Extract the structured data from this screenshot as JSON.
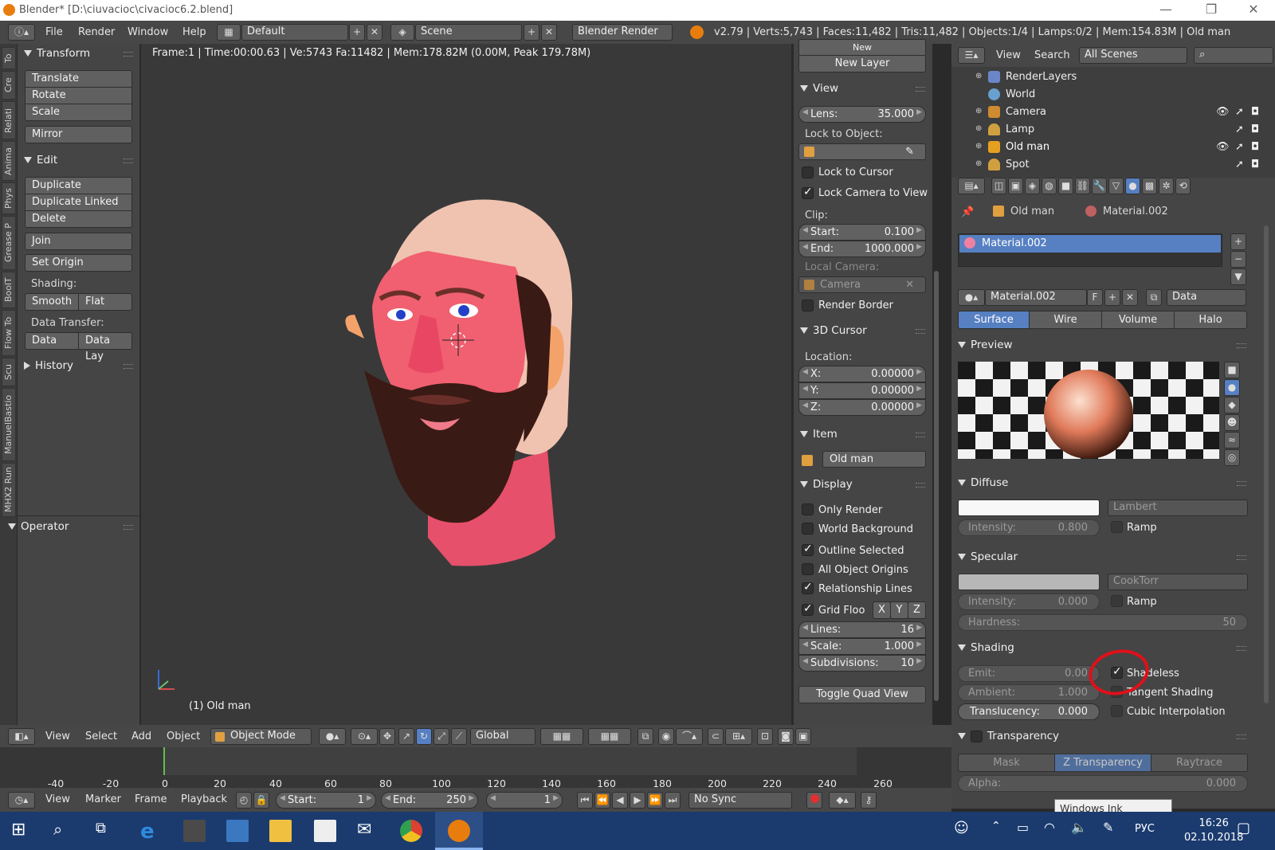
{
  "window": {
    "title": "Blender* [D:\\ciuvacioc\\civacioc6.2.blend]",
    "minimize": "—",
    "maximize": "❐",
    "close": "✕"
  },
  "infobar": {
    "menus": [
      "File",
      "Render",
      "Window",
      "Help"
    ],
    "layout": "Default",
    "scene": "Scene",
    "engine": "Blender Render",
    "stats": "v2.79 | Verts:5,743 | Faces:11,482 | Tris:11,482 | Objects:1/4 | Lamps:0/2 | Mem:154.83M | Old man"
  },
  "tooltabs": [
    "To",
    "Cre",
    "Relati",
    "Anima",
    "Phys",
    "Grease P",
    "BoolT",
    "Flow To",
    "Scu",
    "ManuelBastio",
    "MHX2 Run"
  ],
  "toolshelf": {
    "transform": {
      "title": "Transform",
      "buttons": [
        "Translate",
        "Rotate",
        "Scale",
        "Mirror"
      ]
    },
    "edit": {
      "title": "Edit",
      "buttons": [
        "Duplicate",
        "Duplicate Linked",
        "Delete",
        "Join"
      ],
      "set_origin": "Set Origin"
    },
    "shading_label": "Shading:",
    "shading": [
      "Smooth",
      "Flat"
    ],
    "data_transfer_label": "Data Transfer:",
    "data_transfer": [
      "Data",
      "Data Lay"
    ],
    "history": "History",
    "operator": "Operator"
  },
  "viewport": {
    "info": "Frame:1 | Time:00:00.63 | Ve:5743 Fa:11482 | Mem:178.82M (0.00M, Peak 179.78M)",
    "object_label": "(1) Old man"
  },
  "npanel": {
    "new_top": "New",
    "new_layer": "New Layer",
    "view_title": "View",
    "lens_label": "Lens:",
    "lens_value": "35.000",
    "lock_to_object": "Lock to Object:",
    "lock_to_cursor": "Lock to Cursor",
    "lock_camera": "Lock Camera to View",
    "clip_label": "Clip:",
    "clip_start_label": "Start:",
    "clip_start": "0.100",
    "clip_end_label": "End:",
    "clip_end": "1000.000",
    "local_camera": "Local Camera:",
    "camera": "Camera",
    "render_border": "Render Border",
    "cursor_title": "3D Cursor",
    "location": "Location:",
    "x_label": "X:",
    "x": "0.00000",
    "y_label": "Y:",
    "y": "0.00000",
    "z_label": "Z:",
    "z": "0.00000",
    "item_title": "Item",
    "item_name": "Old man",
    "display_title": "Display",
    "only_render": "Only Render",
    "world_bg": "World Background",
    "outline_selected": "Outline Selected",
    "all_origins": "All Object Origins",
    "relationship": "Relationship Lines",
    "grid_floor": "Grid Floo",
    "axis_x": "X",
    "axis_y": "Y",
    "axis_z": "Z",
    "lines_label": "Lines:",
    "lines": "16",
    "scale_label": "Scale:",
    "scale": "1.000",
    "subdiv_label": "Subdivisions:",
    "subdiv": "10",
    "toggle_quad": "Toggle Quad View"
  },
  "outliner": {
    "menus": [
      "View",
      "Search"
    ],
    "filter": "All Scenes",
    "items": [
      "RenderLayers",
      "World",
      "Camera",
      "Lamp",
      "Old man",
      "Spot"
    ]
  },
  "properties": {
    "breadcrumb_obj": "Old man",
    "breadcrumb_mat": "Material.002",
    "slot": "Material.002",
    "material_name": "Material.002",
    "fake_user": "F",
    "data": "Data",
    "tabs": [
      "Surface",
      "Wire",
      "Volume",
      "Halo"
    ],
    "preview_title": "Preview",
    "diffuse_title": "Diffuse",
    "diffuse_shader": "Lambert",
    "diffuse_intensity_label": "Intensity:",
    "diffuse_intensity": "0.800",
    "ramp": "Ramp",
    "specular_title": "Specular",
    "specular_shader": "CookTorr",
    "specular_intensity_label": "Intensity:",
    "specular_intensity": "0.000",
    "hardness_label": "Hardness:",
    "hardness": "50",
    "shading_title": "Shading",
    "emit_label": "Emit:",
    "emit": "0.00",
    "ambient_label": "Ambient:",
    "ambient": "1.000",
    "translucency_label": "Translucency:",
    "translucency": "0.000",
    "shadeless": "Shadeless",
    "tangent": "Tangent Shading",
    "cubic": "Cubic Interpolation",
    "transparency_title": "Transparency",
    "transp_tabs": [
      "Mask",
      "Z Transparency",
      "Raytrace"
    ],
    "alpha_label": "Alpha:",
    "alpha": "0.000"
  },
  "view3d_header": {
    "menus": [
      "View",
      "Select",
      "Add",
      "Object"
    ],
    "mode": "Object Mode",
    "orientation": "Global"
  },
  "timeline": {
    "ticks": [
      "-40",
      "-20",
      "0",
      "20",
      "40",
      "60",
      "80",
      "100",
      "120",
      "140",
      "160",
      "180",
      "200",
      "220",
      "240",
      "260"
    ],
    "menus": [
      "View",
      "Marker",
      "Frame",
      "Playback"
    ],
    "start_label": "Start:",
    "start": "1",
    "end_label": "End:",
    "end": "250",
    "current": "1",
    "sync": "No Sync"
  },
  "tooltip": "Windows Ink Workspace",
  "taskbar": {
    "lang": "РУС",
    "time": "16:26",
    "date": "02.10.2018"
  },
  "colors": {
    "accent": "#5680c2",
    "highlight_circle": "#e0101a",
    "taskbar": "#1b3b6f"
  }
}
